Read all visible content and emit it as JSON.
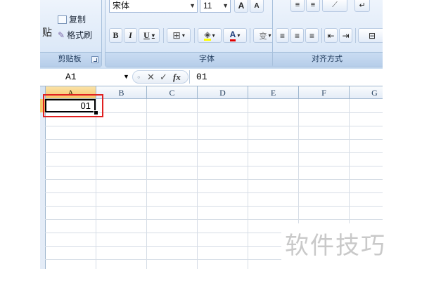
{
  "ribbon": {
    "clipboard": {
      "paste_label": "贴",
      "copy_label": "复制",
      "format_painter_label": "格式刷",
      "group_label": "剪贴板"
    },
    "font": {
      "font_name": "宋体",
      "font_size": "11",
      "bold_label": "B",
      "italic_label": "I",
      "underline_label": "U",
      "phonetic_label": "变",
      "group_label": "字体"
    },
    "alignment": {
      "group_label": "对齐方式"
    }
  },
  "formula_bar": {
    "name_box": "A1",
    "cancel_symbol": "✕",
    "enter_symbol": "✓",
    "fx_label": "fx",
    "content": "01"
  },
  "grid": {
    "columns": [
      "A",
      "B",
      "C",
      "D",
      "E",
      "F",
      "G"
    ],
    "selected_column": "A",
    "cell_a1": "01"
  },
  "watermark": "软件技巧",
  "colors": {
    "highlight": "#e02020",
    "selected_header": "#f5c66a"
  }
}
